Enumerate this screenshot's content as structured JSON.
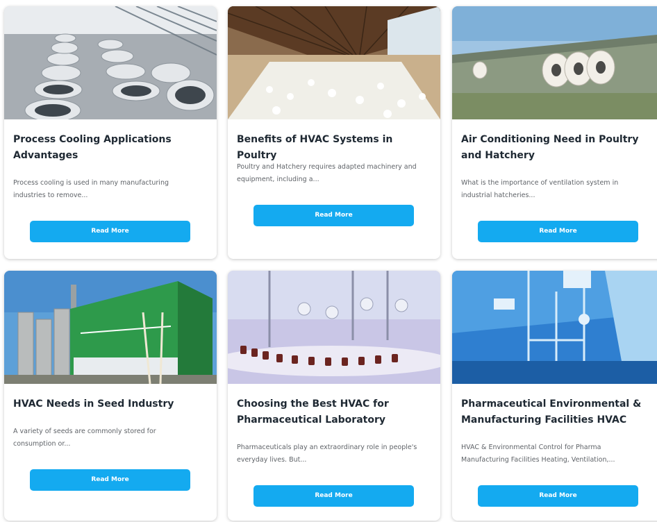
{
  "cards": [
    {
      "title": "Process Cooling Applications Advantages",
      "excerpt": "Process cooling is used in many manufacturing industries to remove...",
      "button": "Read More",
      "image": "cooling-towers-photo"
    },
    {
      "title": "Benefits of HVAC Systems in Poultry",
      "excerpt": "Poultry and Hatchery requires adapted machinery and equipment, including a...",
      "button": "Read More",
      "image": "poultry-house-photo"
    },
    {
      "title": "Air Conditioning Need in Poultry and Hatchery",
      "excerpt": "What is the importance of ventilation system in industrial hatcheries...",
      "button": "Read More",
      "image": "exhaust-fans-building-photo"
    },
    {
      "title": "HVAC Needs in Seed Industry",
      "excerpt": "A variety of seeds are commonly stored for consumption or...",
      "button": "Read More",
      "image": "grain-silo-facility-photo"
    },
    {
      "title": "Choosing the Best HVAC for Pharmaceutical Laboratory",
      "excerpt": "Pharmaceuticals play an extraordinary role in people's everyday lives. But...",
      "button": "Read More",
      "image": "pharma-bottling-line-photo"
    },
    {
      "title": "Pharmaceutical Environmental & Manufacturing Facilities HVAC",
      "excerpt": "HVAC & Environmental Control for Pharma Manufacturing Facilities Heating, Ventilation,...",
      "button": "Read More",
      "image": "pharma-cleanroom-photo"
    }
  ],
  "colors": {
    "button": "#14aaf0",
    "title": "#1f2933",
    "excerpt": "#5f6368"
  }
}
